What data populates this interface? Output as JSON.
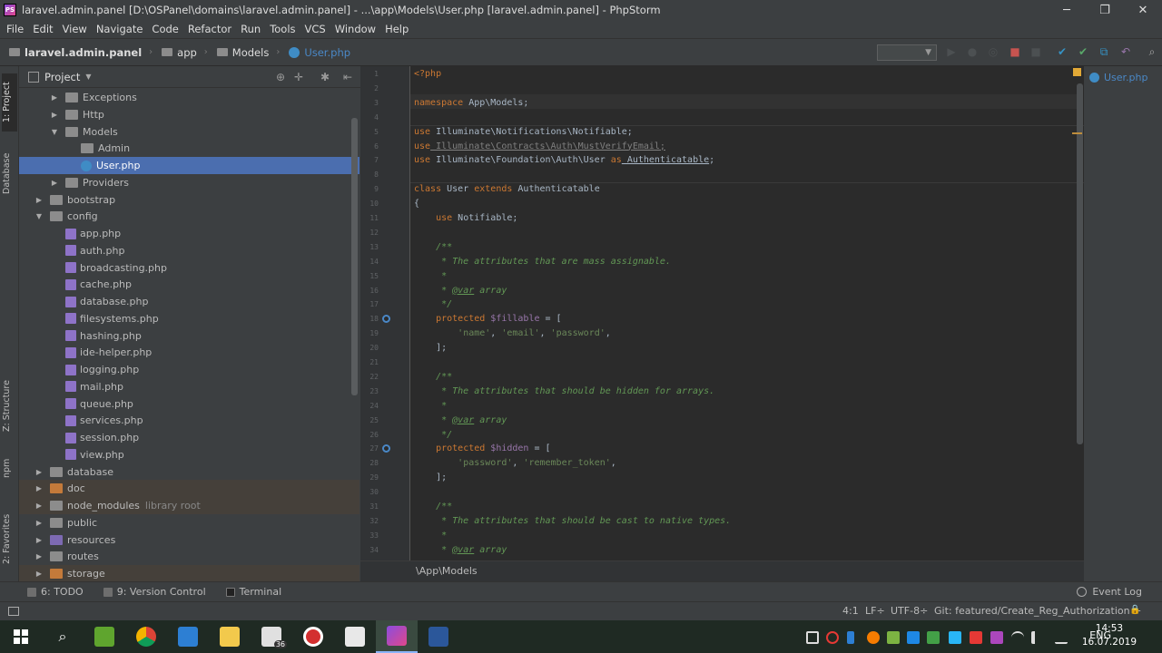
{
  "window": {
    "title": "laravel.admin.panel [D:\\OSPanel\\domains\\laravel.admin.panel] - ...\\app\\Models\\User.php [laravel.admin.panel] - PhpStorm",
    "minimize": "─",
    "maximize": "❐",
    "close": "✕"
  },
  "menu": [
    "File",
    "Edit",
    "View",
    "Navigate",
    "Code",
    "Refactor",
    "Run",
    "Tools",
    "VCS",
    "Window",
    "Help"
  ],
  "breadcrumbs": [
    "laravel.admin.panel",
    "app",
    "Models",
    "User.php"
  ],
  "project_panel": {
    "title": "Project",
    "tree": [
      {
        "label": "Exceptions",
        "depth": 2,
        "type": "folder",
        "arrow": "▶"
      },
      {
        "label": "Http",
        "depth": 2,
        "type": "folder",
        "arrow": "▶"
      },
      {
        "label": "Models",
        "depth": 2,
        "type": "folder",
        "arrow": "▼"
      },
      {
        "label": "Admin",
        "depth": 3,
        "type": "folder",
        "arrow": ""
      },
      {
        "label": "User.php",
        "depth": 3,
        "type": "php",
        "arrow": "",
        "selected": true
      },
      {
        "label": "Providers",
        "depth": 2,
        "type": "folder",
        "arrow": "▶"
      },
      {
        "label": "bootstrap",
        "depth": 1,
        "type": "folder",
        "arrow": "▶"
      },
      {
        "label": "config",
        "depth": 1,
        "type": "folder",
        "arrow": "▼"
      },
      {
        "label": "app.php",
        "depth": 2,
        "type": "cfg",
        "arrow": ""
      },
      {
        "label": "auth.php",
        "depth": 2,
        "type": "cfg",
        "arrow": ""
      },
      {
        "label": "broadcasting.php",
        "depth": 2,
        "type": "cfg",
        "arrow": ""
      },
      {
        "label": "cache.php",
        "depth": 2,
        "type": "cfg",
        "arrow": ""
      },
      {
        "label": "database.php",
        "depth": 2,
        "type": "cfg",
        "arrow": ""
      },
      {
        "label": "filesystems.php",
        "depth": 2,
        "type": "cfg",
        "arrow": ""
      },
      {
        "label": "hashing.php",
        "depth": 2,
        "type": "cfg",
        "arrow": ""
      },
      {
        "label": "ide-helper.php",
        "depth": 2,
        "type": "cfg",
        "arrow": ""
      },
      {
        "label": "logging.php",
        "depth": 2,
        "type": "cfg",
        "arrow": ""
      },
      {
        "label": "mail.php",
        "depth": 2,
        "type": "cfg",
        "arrow": ""
      },
      {
        "label": "queue.php",
        "depth": 2,
        "type": "cfg",
        "arrow": ""
      },
      {
        "label": "services.php",
        "depth": 2,
        "type": "cfg",
        "arrow": ""
      },
      {
        "label": "session.php",
        "depth": 2,
        "type": "cfg",
        "arrow": ""
      },
      {
        "label": "view.php",
        "depth": 2,
        "type": "cfg",
        "arrow": ""
      },
      {
        "label": "database",
        "depth": 1,
        "type": "folder",
        "arrow": "▶"
      },
      {
        "label": "doc",
        "depth": 1,
        "type": "folder-orange",
        "arrow": "▶",
        "excluded": true
      },
      {
        "label": "node_modules",
        "depth": 1,
        "type": "folder",
        "arrow": "▶",
        "hint": "library root",
        "excluded": true
      },
      {
        "label": "public",
        "depth": 1,
        "type": "folder",
        "arrow": "▶"
      },
      {
        "label": "resources",
        "depth": 1,
        "type": "folder-purple",
        "arrow": "▶"
      },
      {
        "label": "routes",
        "depth": 1,
        "type": "folder",
        "arrow": "▶"
      },
      {
        "label": "storage",
        "depth": 1,
        "type": "folder-orange",
        "arrow": "▶",
        "excluded": true
      }
    ]
  },
  "left_stripe_tabs": [
    "1: Project",
    "Database",
    "Z: Structure",
    "npm",
    "2: Favorites"
  ],
  "editor": {
    "tab": "User.php",
    "breadcrumb": "\\App\\Models",
    "lines": [
      {
        "n": "1",
        "html": "<span class='tg'>&lt;?php</span>"
      },
      {
        "n": "2",
        "html": ""
      },
      {
        "n": "3",
        "html": "<span class='kw'>namespace</span><span class='df'> App\\Models;</span>"
      },
      {
        "n": "4",
        "html": ""
      },
      {
        "n": "5",
        "html": "<span class='kw'>use</span><span class='df'> Illuminate\\Notifications\\Notifiable;</span>"
      },
      {
        "n": "6",
        "html": "<span class='kw'>use</span><span class='dim'> Illuminate\\Contracts\\Auth\\MustVerifyEmail;</span>"
      },
      {
        "n": "7",
        "html": "<span class='kw'>use</span><span class='df'> Illuminate\\Foundation\\Auth\\User </span><span class='kw'>as</span><span class='cls'> Authenticatable</span><span class='df'>;</span>"
      },
      {
        "n": "8",
        "html": ""
      },
      {
        "n": "9",
        "html": "<span class='kw'>class</span><span class='df'> User </span><span class='kw'>extends</span><span class='df'> Authenticatable</span>"
      },
      {
        "n": "10",
        "html": "<span class='df'>{</span>"
      },
      {
        "n": "11",
        "html": "<span class='df'>    </span><span class='kw'>use</span><span class='df'> Notifiable;</span>"
      },
      {
        "n": "12",
        "html": ""
      },
      {
        "n": "13",
        "html": "<span class='cm'>    /**</span>"
      },
      {
        "n": "14",
        "html": "<span class='cm'>     * The attributes that are mass assignable.</span>"
      },
      {
        "n": "15",
        "html": "<span class='cm'>     *</span>"
      },
      {
        "n": "16",
        "html": "<span class='cm'>     * </span><span class='tag'>@var</span><span class='cm'> array</span>"
      },
      {
        "n": "17",
        "html": "<span class='cm'>     */</span>"
      },
      {
        "n": "18",
        "html": "<span class='df'>    </span><span class='kw'>protected</span><span class='vr'> $fillable</span><span class='df'> = [</span>"
      },
      {
        "n": "19",
        "html": "<span class='df'>        </span><span class='st'>'name'</span><span class='df'>, </span><span class='st'>'email'</span><span class='df'>, </span><span class='st'>'password'</span><span class='df'>,</span>"
      },
      {
        "n": "20",
        "html": "<span class='df'>    ];</span>"
      },
      {
        "n": "21",
        "html": ""
      },
      {
        "n": "22",
        "html": "<span class='cm'>    /**</span>"
      },
      {
        "n": "23",
        "html": "<span class='cm'>     * The attributes that should be hidden for arrays.</span>"
      },
      {
        "n": "24",
        "html": "<span class='cm'>     *</span>"
      },
      {
        "n": "25",
        "html": "<span class='cm'>     * </span><span class='tag'>@var</span><span class='cm'> array</span>"
      },
      {
        "n": "26",
        "html": "<span class='cm'>     */</span>"
      },
      {
        "n": "27",
        "html": "<span class='df'>    </span><span class='kw'>protected</span><span class='vr'> $hidden</span><span class='df'> = [</span>"
      },
      {
        "n": "28",
        "html": "<span class='df'>        </span><span class='st'>'password'</span><span class='df'>, </span><span class='st'>'remember_token'</span><span class='df'>,</span>"
      },
      {
        "n": "29",
        "html": "<span class='df'>    ];</span>"
      },
      {
        "n": "30",
        "html": ""
      },
      {
        "n": "31",
        "html": "<span class='cm'>    /**</span>"
      },
      {
        "n": "32",
        "html": "<span class='cm'>     * The attributes that should be cast to native types.</span>"
      },
      {
        "n": "33",
        "html": "<span class='cm'>     *</span>"
      },
      {
        "n": "34",
        "html": "<span class='cm'>     * </span><span class='tag'>@var</span><span class='cm'> array</span>"
      }
    ]
  },
  "bottom_tools": {
    "todo": "6: TODO",
    "vcs": "9: Version Control",
    "terminal": "Terminal",
    "event_log": "Event Log"
  },
  "status": {
    "position": "4:1",
    "line_sep": "LF÷",
    "encoding": "UTF-8÷",
    "git": "Git: featured/Create_Reg_Authorization ÷",
    "lock": "🔒"
  },
  "taskbar": {
    "mail_badge": "36",
    "lang": "ENG",
    "time": "14:53",
    "date": "16.07.2019"
  },
  "colors": {
    "selection": "#4b6eaf",
    "php_icon": "#3f8cc5",
    "keyword": "#cc7832",
    "comment": "#629755"
  }
}
